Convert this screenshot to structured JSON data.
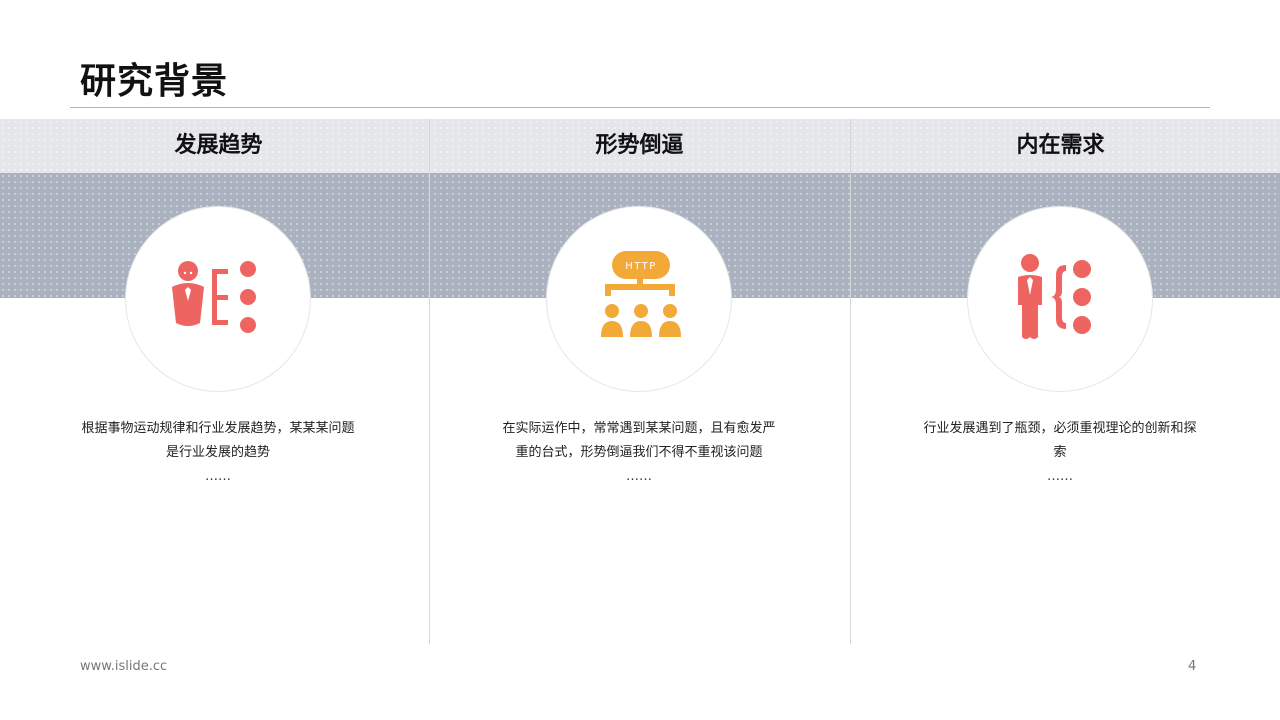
{
  "slide": {
    "title": "研究背景",
    "page_number": "4",
    "footer_url": "www.islide.cc"
  },
  "columns": [
    {
      "heading": "发展趋势",
      "icon": "person-with-options-icon",
      "icon_color": "#EE6461",
      "text": "根据事物运动规律和行业发展趋势，某某某问题是行业发展的趋势",
      "ellipsis": "……"
    },
    {
      "heading": "形势倒逼",
      "icon": "http-network-users-icon",
      "icon_color": "#F3A937",
      "icon_label": "HTTP",
      "text": "在实际运作中，常常遇到某某问题，且有愈发严重的台式，形势倒逼我们不得不重视该问题",
      "ellipsis": "……"
    },
    {
      "heading": "内在需求",
      "icon": "businessman-choice-icon",
      "icon_color": "#EE6461",
      "text": "行业发展遇到了瓶颈，必须重视理论的创新和探索",
      "ellipsis": "……"
    }
  ],
  "colors": {
    "header_band": "#E4E6EA",
    "pattern_band": "#AAB2C0",
    "accent_red": "#EE6461",
    "accent_orange": "#F3A937"
  }
}
